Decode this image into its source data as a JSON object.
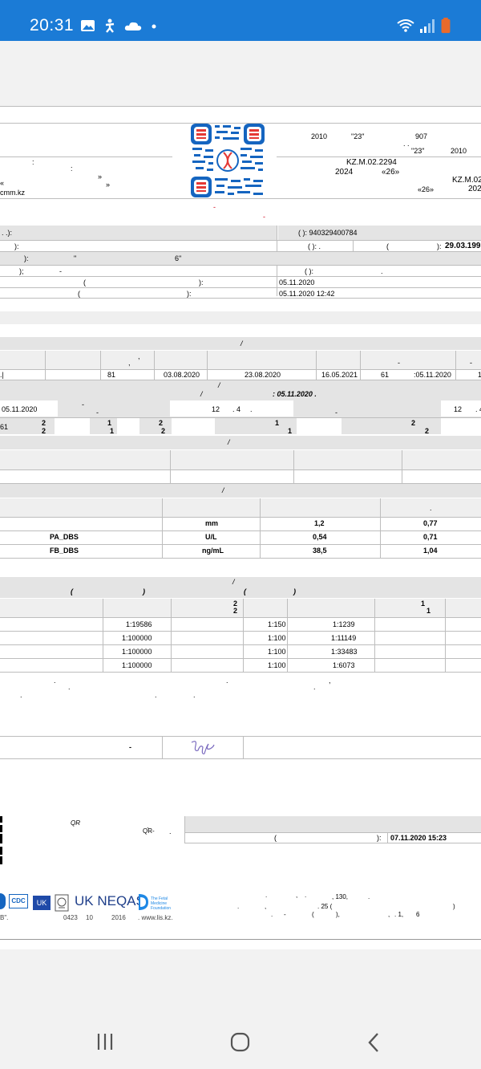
{
  "status": {
    "time": "20:31"
  },
  "header": {
    "left_lines": [
      ":",
      ":",
      "«",
      "»",
      "»",
      "cmm.kz"
    ],
    "year1": "2010",
    "day1": "\"23\"",
    "num1": "907",
    "day2": "\"23\"",
    "year2": "2010",
    "license": "KZ.M.02.2294",
    "year3": "2024",
    "day3": "«26»",
    "license_cut": "KZ.M.02",
    "day4": "«26»",
    "year_cut": "202",
    "red_dash": "-"
  },
  "patient": {
    "iin_label": "(     ): 940329400784",
    "birth_label": "): ",
    "birth_date": "29.03.199",
    "row3_a": "):",
    "row3_b": "\"",
    "row3_c": "6\"",
    "row4_a": ");",
    "row4_b": "-",
    "row4_c": "(      ):",
    "row4_d": ".",
    "date1": "05.11.2020",
    "date2": "05.11.2020 12:42"
  },
  "section1": {
    "title": "/",
    "row": {
      "c1": "81",
      "c2": "03.08.2020",
      "c3": "23.08.2020",
      "c4": "16.05.2021",
      "c5": "61",
      "c6": ":05.11.2020",
      "c7": "1"
    },
    "sub_title": "/",
    "sub_title_date": ": 05.11.2020 .",
    "date_a": "05.11.2020",
    "val_a": "12",
    "val_b": ". 4",
    "val_c": "12",
    "val_d": ". 4",
    "nums": [
      "61",
      "2",
      "2",
      "1",
      "1",
      "2",
      "2",
      "1",
      "1",
      "2",
      "2"
    ]
  },
  "section2": {
    "title": "/"
  },
  "section3": {
    "title": "/",
    "rows": [
      {
        "name": "",
        "unit": "mm",
        "v1": "1,2",
        "v2": "0,77"
      },
      {
        "name": "PA_DBS",
        "unit": "U/L",
        "v1": "0,54",
        "v2": "0,71"
      },
      {
        "name": "FB_DBS",
        "unit": "ng/mL",
        "v1": "38,5",
        "v2": "1,04"
      }
    ]
  },
  "section4": {
    "title": "/",
    "head_a": "(",
    "head_b": ")",
    "head_c": "(",
    "head_d": ")",
    "head_e": "2",
    "head_f": "2",
    "head_g": "1",
    "head_h": "1",
    "rows": [
      {
        "a": "1:19586",
        "b": "1:150",
        "c": "1:1239"
      },
      {
        "a": "1:100000",
        "b": "1:100",
        "c": "1:11149"
      },
      {
        "a": "1:100000",
        "b": "1:100",
        "c": "1:33483"
      },
      {
        "a": "1:100000",
        "b": "1:100",
        "c": "1:6073"
      }
    ]
  },
  "signature": {
    "dash": "-"
  },
  "qr_block": {
    "qr1": "QR",
    "qr2": "QR-",
    "dot": ".",
    "paren": "(",
    "close": "):",
    "datetime": "07.11.2020 15:23"
  },
  "footer": {
    "logos": [
      "CDC",
      "UK",
      "UK NEQAS",
      "The Fetal Medicine Foundation"
    ],
    "b_text": "B\".",
    "cert_a": "0423",
    "cert_b": "10",
    "cert_c": "2016",
    "site": ". www.lis.kz.",
    "addr1": ", 130,",
    "addr2": ". 25 (",
    "addr3": "),",
    "addr4": ". 1,",
    "addr5": "6",
    "addr6": ")"
  }
}
